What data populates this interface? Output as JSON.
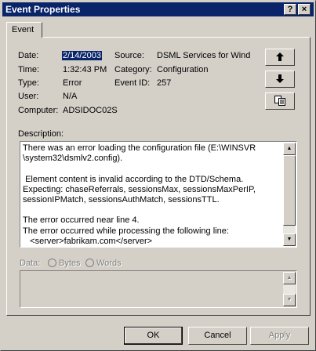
{
  "window": {
    "title": "Event Properties",
    "help_glyph": "?",
    "close_glyph": "×"
  },
  "tab": {
    "label": "Event"
  },
  "fields": {
    "date_label": "Date:",
    "date_value": "2/14/2003",
    "time_label": "Time:",
    "time_value": "1:32:43 PM",
    "type_label": "Type:",
    "type_value": "Error",
    "user_label": "User:",
    "user_value": "N/A",
    "computer_label": "Computer:",
    "computer_value": "ADSIDOC02S",
    "source_label": "Source:",
    "source_value": "DSML Services for Wind",
    "category_label": "Category:",
    "category_value": "Configuration",
    "eventid_label": "Event ID:",
    "eventid_value": "257"
  },
  "description": {
    "label": "Description:",
    "text": "There was an error loading the configuration file (E:\\WINSVR\n\\system32\\dsmlv2.config).\n\n Element content is invalid according to the DTD/Schema.\nExpecting: chaseReferrals, sessionsMax, sessionsMaxPerIP,\nsessionIPMatch, sessionsAuthMatch, sessionsTTL.\n\nThe error occurred near line 4.\nThe error occurred while processing the following line:\n   <server>fabrikam.com</server>"
  },
  "data_section": {
    "label": "Data:",
    "bytes_label": "Bytes",
    "words_label": "Words"
  },
  "buttons": {
    "ok": "OK",
    "cancel": "Cancel",
    "apply": "Apply"
  },
  "icons": {
    "up": "arrow-up-icon",
    "down": "arrow-down-icon",
    "copy": "copy-icon"
  }
}
